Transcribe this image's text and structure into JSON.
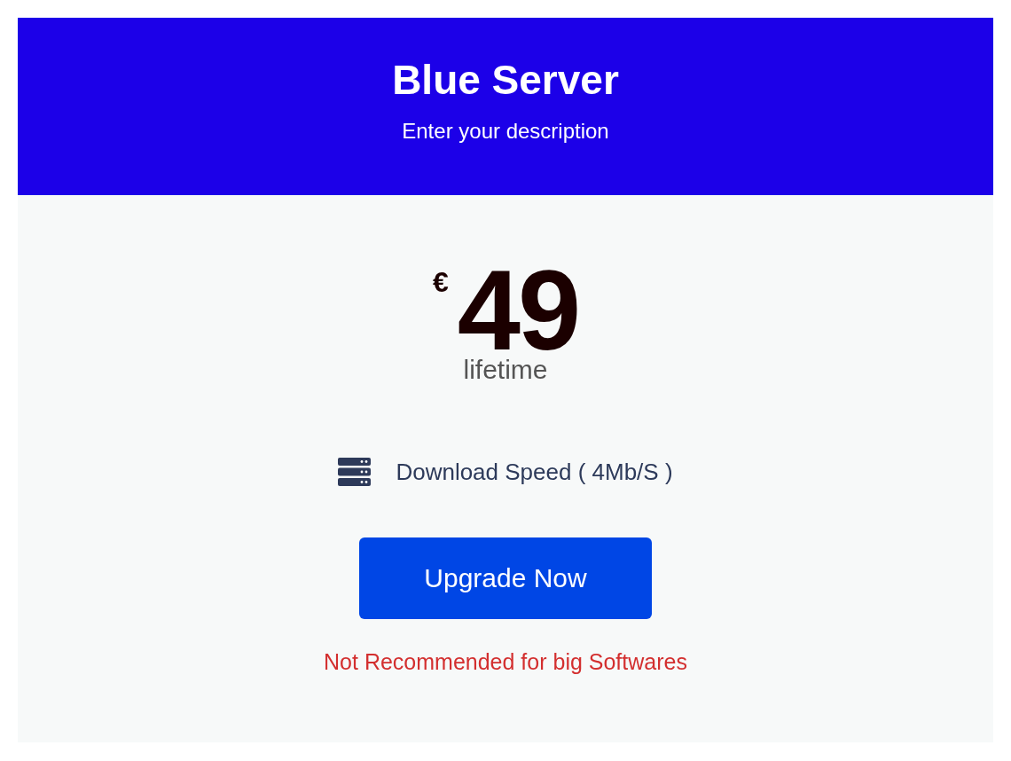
{
  "plan": {
    "title": "Blue Server",
    "description": "Enter your description",
    "currency": "€",
    "price": "49",
    "period": "lifetime"
  },
  "features": [
    {
      "label": "Download Speed ( 4Mb/S )"
    }
  ],
  "button": {
    "label": "Upgrade Now"
  },
  "note": "Not Recommended for big Softwares"
}
